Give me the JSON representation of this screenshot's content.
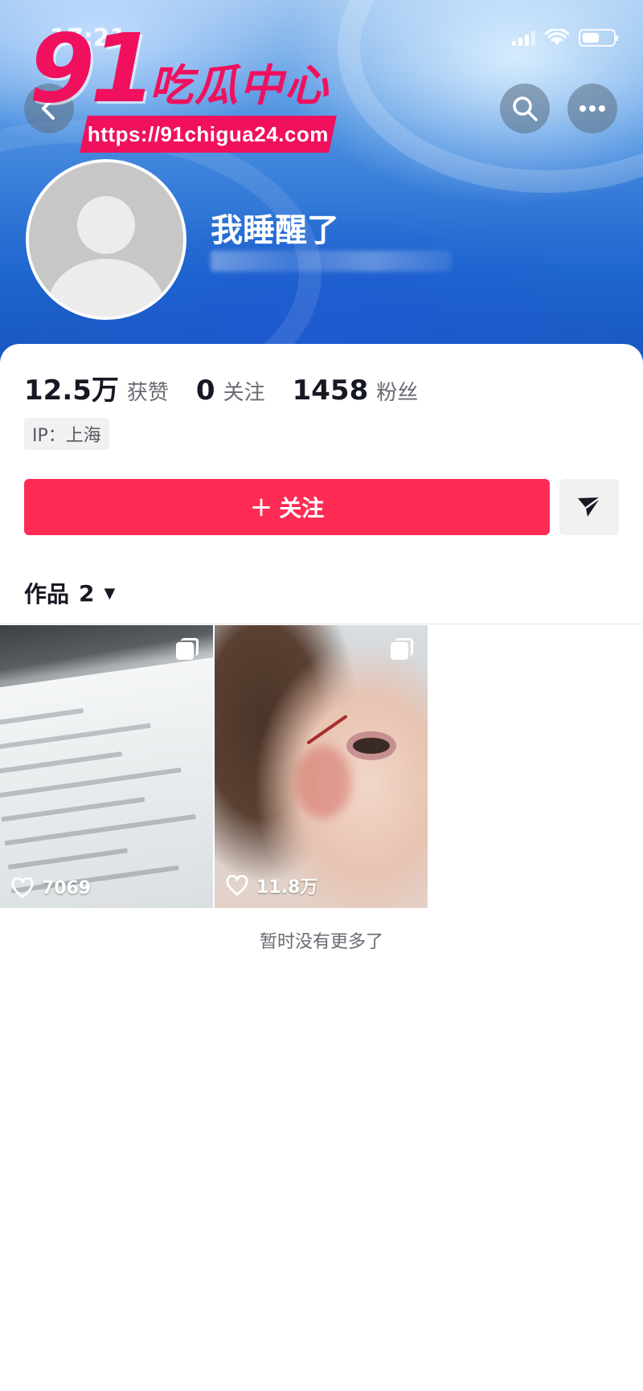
{
  "status_bar": {
    "time": "17:21"
  },
  "watermark": {
    "big": "91",
    "cn": "吃瓜中心",
    "url": "https://91chigua24.com"
  },
  "profile": {
    "nickname": "我睡醒了",
    "stats": [
      {
        "value": "12.5万",
        "label": "获赞"
      },
      {
        "value": "0",
        "label": "关注"
      },
      {
        "value": "1458",
        "label": "粉丝"
      }
    ],
    "ip": "IP：上海"
  },
  "actions": {
    "follow_label": "关注",
    "follow_plus": "+"
  },
  "works": {
    "tab_label": "作品",
    "count": "2",
    "items": [
      {
        "likes": "7069",
        "icon": "multi-image-icon"
      },
      {
        "likes": "11.8万",
        "icon": "multi-image-icon"
      }
    ],
    "no_more": "暂时没有更多了"
  },
  "colors": {
    "accent": "#fe2c55",
    "watermark": "#f0105e",
    "banner": "#1f66cf"
  }
}
